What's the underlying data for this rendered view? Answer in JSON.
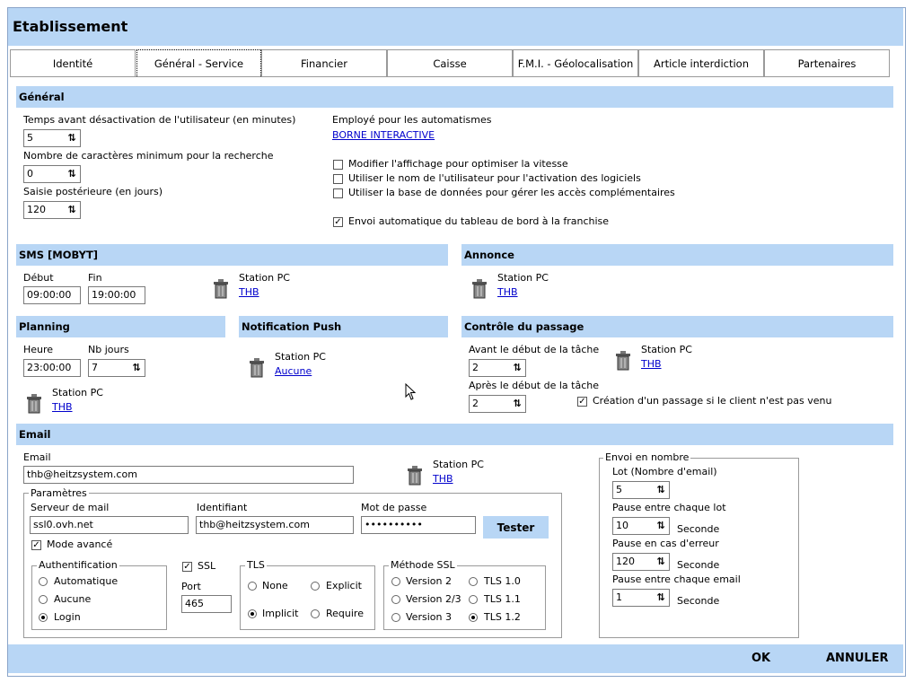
{
  "window": {
    "title": "Etablissement"
  },
  "tabs": [
    "Identité",
    "Général - Service",
    "Financier",
    "Caisse",
    "F.M.I. - Géolocalisation",
    "Article interdiction",
    "Partenaires"
  ],
  "general": {
    "header": "Général",
    "temps_label": "Temps avant désactivation de l'utilisateur (en minutes)",
    "temps_value": "5",
    "nbcar_label": "Nombre de caractères minimum pour la recherche",
    "nbcar_value": "0",
    "saisie_label": "Saisie postérieure (en jours)",
    "saisie_value": "120",
    "employe_label": "Employé pour les automatismes",
    "employe_link": "BORNE INTERACTIVE",
    "checks": [
      {
        "label": "Modifier l'affichage pour optimiser la vitesse",
        "checked": false
      },
      {
        "label": "Utiliser le nom de l'utilisateur pour l'activation des logiciels",
        "checked": false
      },
      {
        "label": "Utiliser la base de données pour gérer les accès complémentaires",
        "checked": false
      },
      {
        "label": "Envoi automatique du tableau de bord à la franchise",
        "checked": true
      }
    ]
  },
  "sms": {
    "header": "SMS [MOBYT]",
    "debut_label": "Début",
    "debut_value": "09:00:00",
    "fin_label": "Fin",
    "fin_value": "19:00:00",
    "station_label": "Station PC",
    "station_link": "THB"
  },
  "annonce": {
    "header": "Annonce",
    "station_label": "Station PC",
    "station_link": "THB"
  },
  "planning": {
    "header": "Planning",
    "heure_label": "Heure",
    "heure_value": "23:00:00",
    "nbjours_label": "Nb jours",
    "nbjours_value": "7",
    "station_label": "Station PC",
    "station_link": "THB"
  },
  "push": {
    "header": "Notification Push",
    "station_label": "Station PC",
    "station_link": "Aucune"
  },
  "controle": {
    "header": "Contrôle du passage",
    "avant_label": "Avant le début de la tâche",
    "avant_value": "2",
    "apres_label": "Après le début de la tâche",
    "apres_value": "2",
    "station_label": "Station PC",
    "station_link": "THB",
    "creation_label": "Création d'un passage si le client n'est pas venu",
    "creation_checked": true
  },
  "email": {
    "header": "Email",
    "email_label": "Email",
    "email_value": "thb@heitzsystem.com",
    "station_label": "Station PC",
    "station_link": "THB",
    "params_title": "Paramètres",
    "serveur_label": "Serveur de mail",
    "serveur_value": "ssl0.ovh.net",
    "ident_label": "Identifiant",
    "ident_value": "thb@heitzsystem.com",
    "mdp_label": "Mot de passe",
    "mdp_value": "••••••••••",
    "tester_label": "Tester",
    "mode_label": "Mode avancé",
    "mode_checked": true,
    "auth_title": "Authentification",
    "auth_options": [
      {
        "label": "Automatique",
        "selected": false
      },
      {
        "label": "Aucune",
        "selected": false
      },
      {
        "label": "Login",
        "selected": true
      }
    ],
    "ssl_label": "SSL",
    "ssl_checked": true,
    "port_label": "Port",
    "port_value": "465",
    "tls_title": "TLS",
    "tls_options": [
      {
        "label": "None",
        "selected": false
      },
      {
        "label": "Explicit",
        "selected": false
      },
      {
        "label": "Implicit",
        "selected": true
      },
      {
        "label": "Require",
        "selected": false
      }
    ],
    "ssl_method_title": "Méthode SSL",
    "ssl_methods": [
      {
        "label": "Version 2",
        "selected": false
      },
      {
        "label": "TLS 1.0",
        "selected": false
      },
      {
        "label": "Version 2/3",
        "selected": false
      },
      {
        "label": "TLS 1.1",
        "selected": false
      },
      {
        "label": "Version 3",
        "selected": false
      },
      {
        "label": "TLS 1.2",
        "selected": true
      }
    ]
  },
  "envoi": {
    "title": "Envoi en nombre",
    "lot_label": "Lot (Nombre d'email)",
    "lot_value": "5",
    "pause_lot_label": "Pause entre chaque lot",
    "pause_lot_value": "10",
    "pause_err_label": "Pause en cas d'erreur",
    "pause_err_value": "120",
    "pause_email_label": "Pause entre chaque email",
    "pause_email_value": "1",
    "unit": "Seconde"
  },
  "footer": {
    "ok_label": "OK",
    "cancel_label": "ANNULER"
  }
}
